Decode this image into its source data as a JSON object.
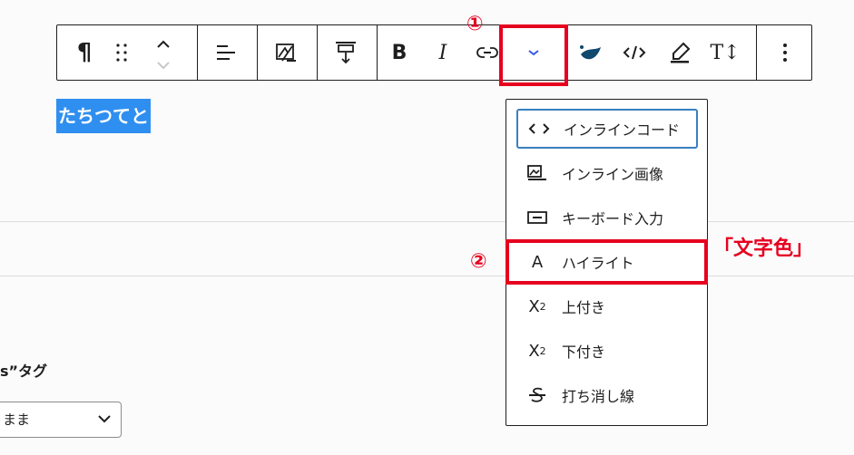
{
  "toolbar": {
    "paragraph_icon": "pilcrow-icon",
    "drag_icon": "drag-handle-icon",
    "move_up_icon": "chevron-up-icon",
    "move_down_icon": "chevron-down-icon",
    "align_icon": "align-left-icon",
    "media_icon": "image-text-icon",
    "height_icon": "vertical-spacing-icon",
    "bold_label": "B",
    "italic_label": "I",
    "link_icon": "link-icon",
    "more_icon": "chevron-down-icon",
    "color_icon": "paint-drop-icon",
    "code_icon": "code-icon",
    "highlighter_icon": "highlighter-icon",
    "typography_label": "T↕",
    "options_icon": "more-vertical-icon"
  },
  "editor": {
    "selected_text": "たちつてと"
  },
  "sidebar": {
    "heading": "s”タグ",
    "select_value": "まま"
  },
  "dropdown": {
    "items": [
      {
        "label": "インラインコード",
        "icon": "code-icon"
      },
      {
        "label": "インライン画像",
        "icon": "inline-image-icon"
      },
      {
        "label": "キーボード入力",
        "icon": "keyboard-input-icon"
      },
      {
        "label": "ハイライト",
        "icon": "letter-a-icon"
      },
      {
        "label": "上付き",
        "icon": "superscript-icon"
      },
      {
        "label": "下付き",
        "icon": "subscript-icon"
      },
      {
        "label": "打ち消し線",
        "icon": "strikethrough-icon"
      }
    ]
  },
  "annotations": {
    "step1": "①",
    "step2": "②",
    "callout": "「文字色」",
    "color": "#e6001f"
  },
  "colors": {
    "selection": "#2f8ff0",
    "focus": "#3a7fbe",
    "accent_chevron": "#3858e9"
  }
}
